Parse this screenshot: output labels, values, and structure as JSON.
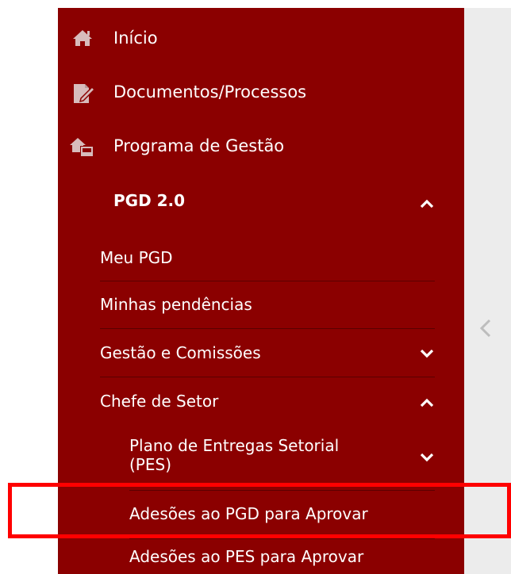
{
  "menu": {
    "inicio": {
      "label": "Início",
      "icon": "home-icon"
    },
    "documentos": {
      "label": "Documentos/Processos",
      "icon": "edit-document-icon"
    },
    "programa": {
      "label": "Programa de Gestão",
      "icon": "home-gear-icon"
    },
    "pgd": {
      "label": "PGD 2.0",
      "expanded": true
    },
    "meu_pgd": {
      "label": "Meu PGD"
    },
    "pendencias": {
      "label": "Minhas pendências"
    },
    "gestao": {
      "label": "Gestão e Comissões",
      "expanded": false
    },
    "chefe": {
      "label": "Chefe de Setor",
      "expanded": true
    },
    "plano": {
      "label_line1": "Plano de Entregas Setorial",
      "label_line2": "(PES)",
      "expanded": false
    },
    "adesoes_pgd": {
      "label": "Adesões ao PGD para Aprovar",
      "highlighted": true
    },
    "adesoes_pes": {
      "label": "Adesões ao PES para Aprovar"
    }
  },
  "colors": {
    "sidebar_bg": "#8b0000",
    "highlight": "#ff0000",
    "side_panel": "#ececec"
  }
}
